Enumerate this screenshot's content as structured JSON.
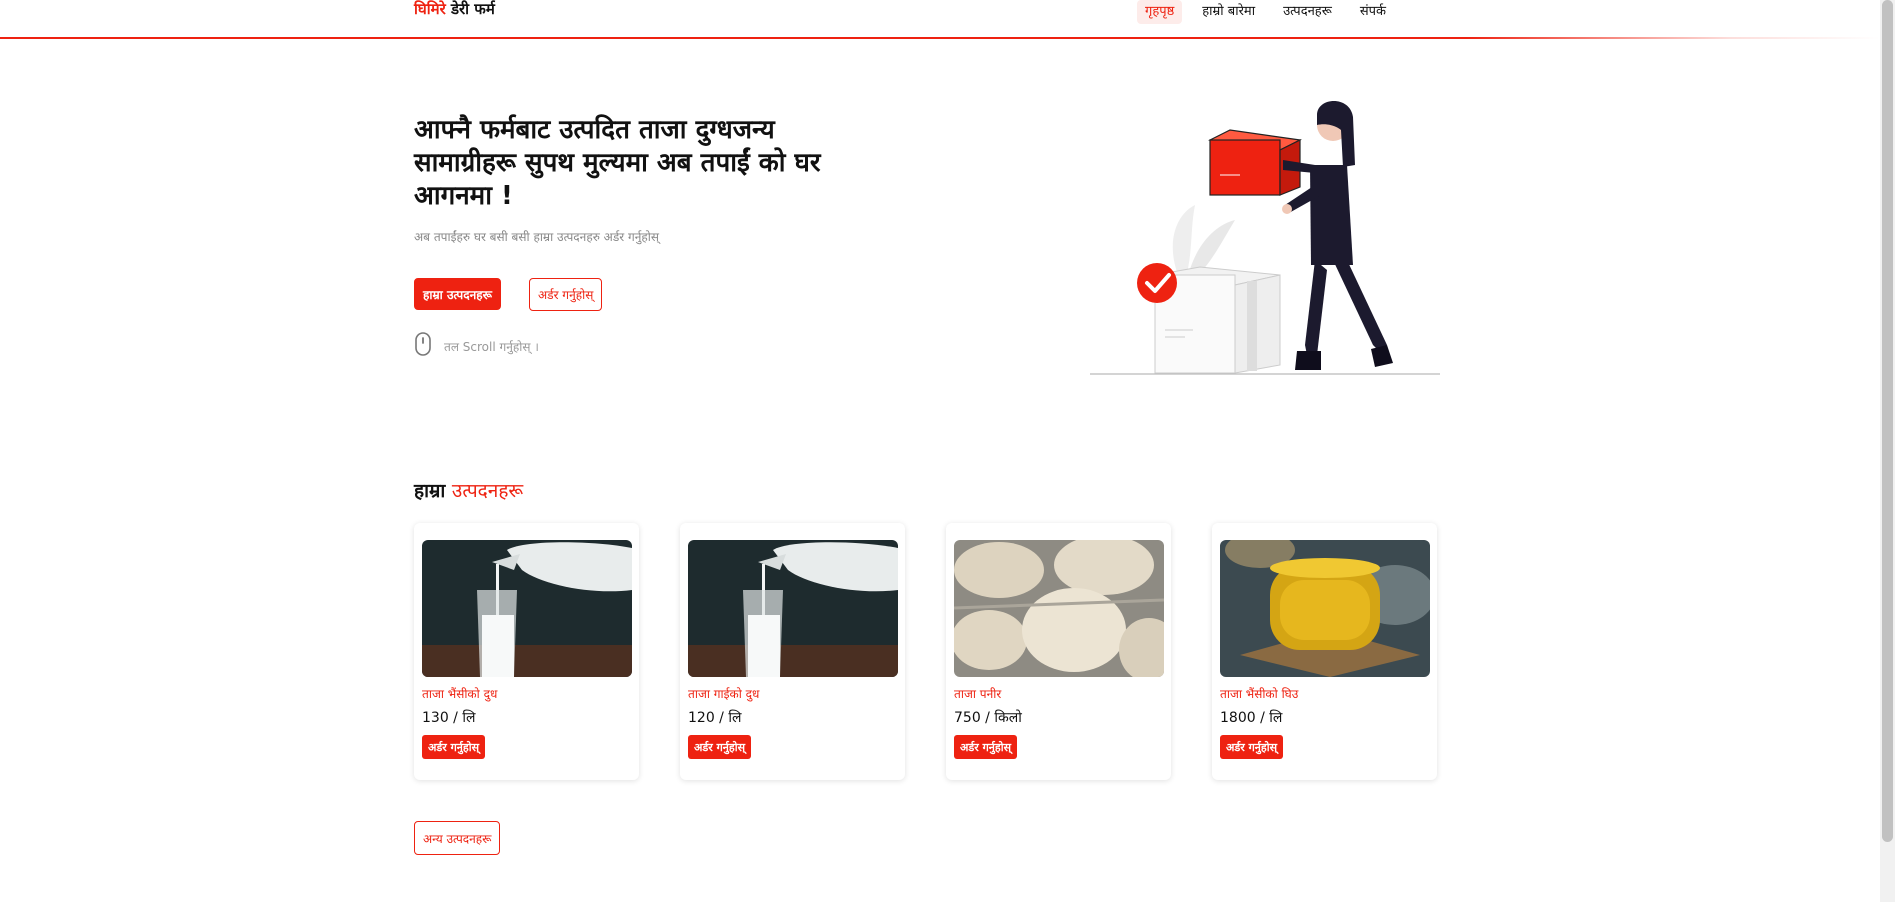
{
  "colors": {
    "accent": "#ee2211",
    "text": "#111111",
    "muted": "#888888"
  },
  "header": {
    "brand_part1": "घिमिरे",
    "brand_part2": "डेरी फर्म",
    "nav": [
      {
        "label": "गृहपृष्ठ",
        "active": true
      },
      {
        "label": "हाम्रो बारेमा"
      },
      {
        "label": "उत्पदनहरू"
      },
      {
        "label": "संपर्क"
      }
    ]
  },
  "hero": {
    "title": "आफ्नै फर्मबाट उत्पदित ताजा दुग्धजन्य सामाग्रीहरू सुपथ मुल्यमा अब तपाईं को घर आगनमा !",
    "subtitle": "अब तपाईंहरु घर बसी बसी हाम्रा उत्पदनहरु अर्डर गर्नुहोस्",
    "primary_button": "हाम्रा उत्पदनहरू",
    "secondary_button": "अर्डर गर्नुहोस्",
    "scroll_hint": "तल Scroll गर्नुहोस् ।",
    "illustration_icon": "delivery-person-with-box"
  },
  "products_section": {
    "title_part1": "हाम्रा",
    "title_part2": "उत्पदनहरू",
    "items": [
      {
        "name": "ताजा भैंसीको दुध",
        "price": "130 / लि",
        "order_label": "अर्डर गर्नुहोस्",
        "image": "milk-pour-image"
      },
      {
        "name": "ताजा गाईको दुध",
        "price": "120 / लि",
        "order_label": "अर्डर गर्नुहोस्",
        "image": "milk-pour-image"
      },
      {
        "name": "ताजा पनीर",
        "price": "750 / किलो",
        "order_label": "अर्डर गर्नुहोस्",
        "image": "paneer-image"
      },
      {
        "name": "ताजा भैंसीको घिउ",
        "price": "1800 / लि",
        "order_label": "अर्डर गर्नुहोस्",
        "image": "ghee-jar-image"
      }
    ],
    "more_button": "अन्य उत्पदनहरू"
  }
}
